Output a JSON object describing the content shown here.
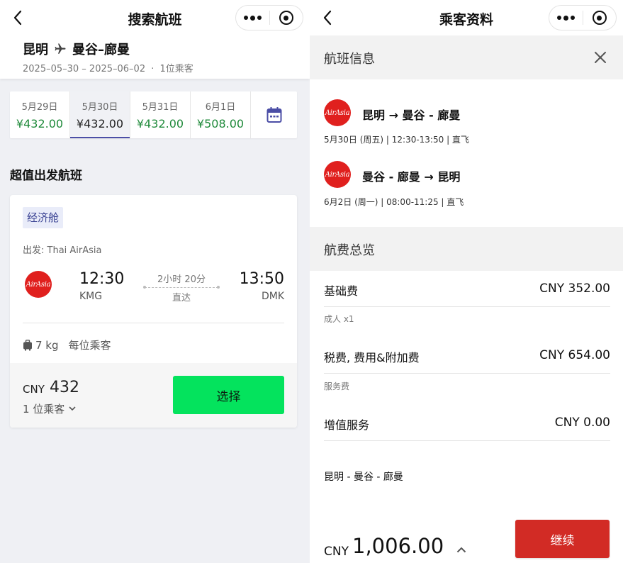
{
  "search": {
    "nav": {
      "title": "搜索航班"
    },
    "route": {
      "origin": "昆明",
      "destination": "曼谷–廊曼",
      "dates": "2025–05–30 – 2025–06–02",
      "passengers": "1位乘客",
      "separator": "·"
    },
    "dates": [
      {
        "date": "5月29日",
        "price": "¥432.00",
        "selected": false
      },
      {
        "date": "5月30日",
        "price": "¥432.00",
        "selected": true
      },
      {
        "date": "5月31日",
        "price": "¥432.00",
        "selected": false
      },
      {
        "date": "6月1日",
        "price": "¥508.00",
        "selected": false
      }
    ],
    "section_title": "超值出发航班",
    "card": {
      "cabin": "经济舱",
      "operator": "出发: Thai AirAsia",
      "airline_logo": "AirAsia",
      "dep_time": "12:30",
      "dep_code": "KMG",
      "arr_time": "13:50",
      "arr_code": "DMK",
      "duration": "2小时 20分",
      "stops": "直达",
      "baggage_weight": "7 kg",
      "baggage_note": "每位乘客",
      "currency": "CNY",
      "price": "432",
      "pax": "1 位乘客",
      "select_label": "选择"
    }
  },
  "passenger": {
    "nav": {
      "title": "乘客资料"
    },
    "flight_info_title": "航班信息",
    "segments": [
      {
        "logo": "AirAsia",
        "route": "昆明 → 曼谷 - 廊曼",
        "info": "5月30日 (周五) | 12:30-13:50 | 直飞"
      },
      {
        "logo": "AirAsia",
        "route": "曼谷 - 廊曼 → 昆明",
        "info": "6月2日 (周一) | 08:00-11:25 | 直飞"
      }
    ],
    "fare_title": "航费总览",
    "fees": [
      {
        "label": "基础费",
        "amount": "CNY  352.00",
        "sub": "成人 x1"
      },
      {
        "label": "税费, 费用&附加费",
        "amount": "CNY  654.00",
        "sub": "服务费"
      },
      {
        "label": "增值服务",
        "amount": "CNY  0.00",
        "sub": ""
      }
    ],
    "route_note": "昆明 - 曼谷 - 廊曼",
    "total_currency": "CNY",
    "total_amount": "1,006.00",
    "continue_label": "继续"
  },
  "colors": {
    "price_green": "#1f8a3a",
    "select_green": "#04e35d",
    "continue_red": "#d22b25",
    "airasia_red": "#e0201e",
    "tab_indicator": "#4b4ea6"
  }
}
